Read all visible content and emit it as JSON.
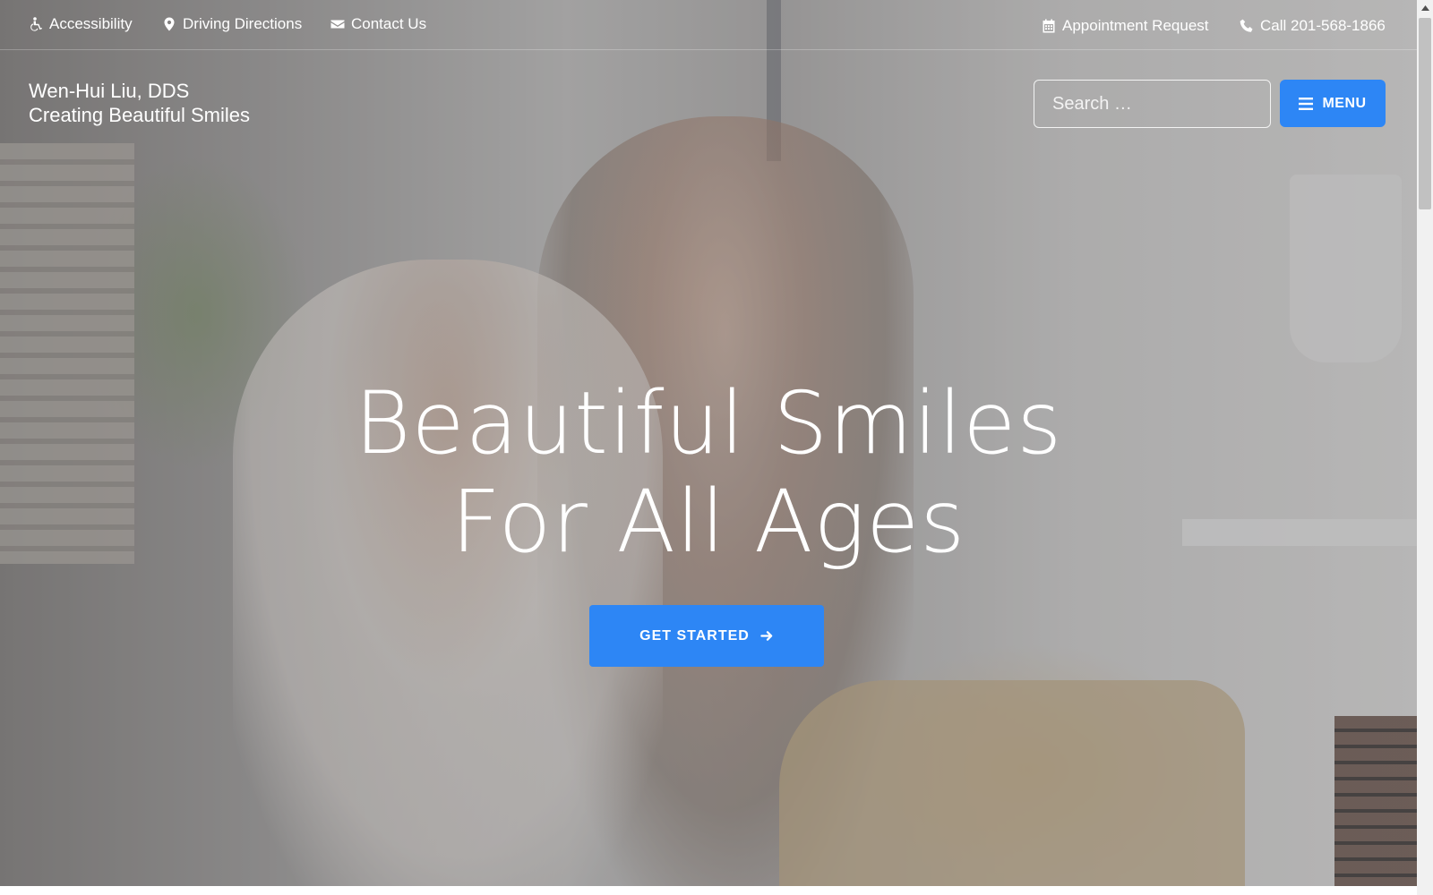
{
  "topbar": {
    "accessibility": "Accessibility",
    "directions": "Driving Directions",
    "contact": "Contact Us",
    "appointment": "Appointment Request",
    "phone": "Call 201-568-1866"
  },
  "brand": {
    "name": "Wen-Hui Liu, DDS",
    "tagline": "Creating Beautiful Smiles"
  },
  "search": {
    "placeholder": "Search …",
    "value": ""
  },
  "menu": {
    "label": "MENU"
  },
  "hero": {
    "line1": "Beautiful Smiles",
    "line2": "For All Ages",
    "cta_label": "GET STARTED"
  },
  "icons": {
    "accessibility": "wheelchair-icon",
    "directions": "map-marker-icon",
    "contact": "envelope-icon",
    "appointment": "calendar-icon",
    "phone": "phone-icon",
    "search": "search-icon",
    "menu": "hamburger-icon",
    "cta": "arrow-right-icon"
  },
  "colors": {
    "accent": "#2d86f5",
    "text": "#ffffff"
  }
}
